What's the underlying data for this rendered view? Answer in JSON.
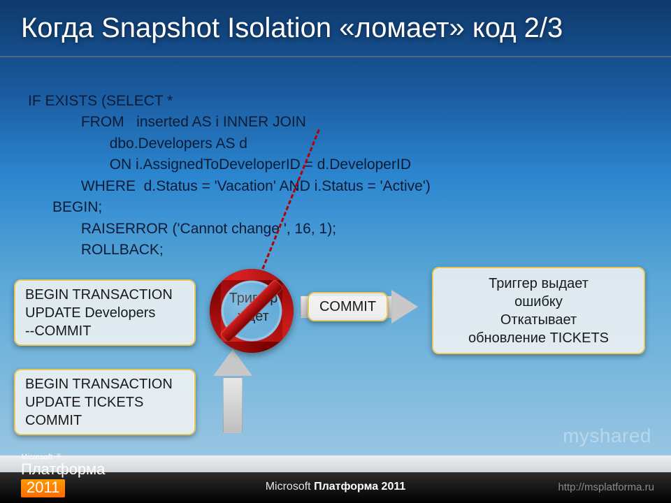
{
  "title": "Когда Snapshot Isolation «ломает» код 2/3",
  "code": "IF EXISTS (SELECT *\n             FROM   inserted AS i INNER JOIN\n                    dbo.Developers AS d\n                    ON i.AssignedToDeveloperID = d.DeveloperID\n             WHERE  d.Status = 'Vacation' AND i.Status = 'Active')\n      BEGIN;\n             RAISERROR ('Cannot change ', 16, 1);\n             ROLLBACK;",
  "boxes": {
    "dev": "BEGIN TRANSACTION\nUPDATE Developers\n--COMMIT",
    "tickets": "BEGIN TRANSACTION\nUPDATE TICKETS\nCOMMIT",
    "trigger_wait": "Триггер\nждет",
    "commit": "COMMIT",
    "result": "Триггер выдает\nошибку\nОткатывает\nобновление TICKETS"
  },
  "footer": {
    "brand_small": "Microsoft",
    "brand_name": "Платформа",
    "brand_year": "2011",
    "center_prefix": "Microsoft ",
    "center_bold": "Платформа 2011",
    "right": "http://msplatforma.ru"
  },
  "watermark": "myshared"
}
